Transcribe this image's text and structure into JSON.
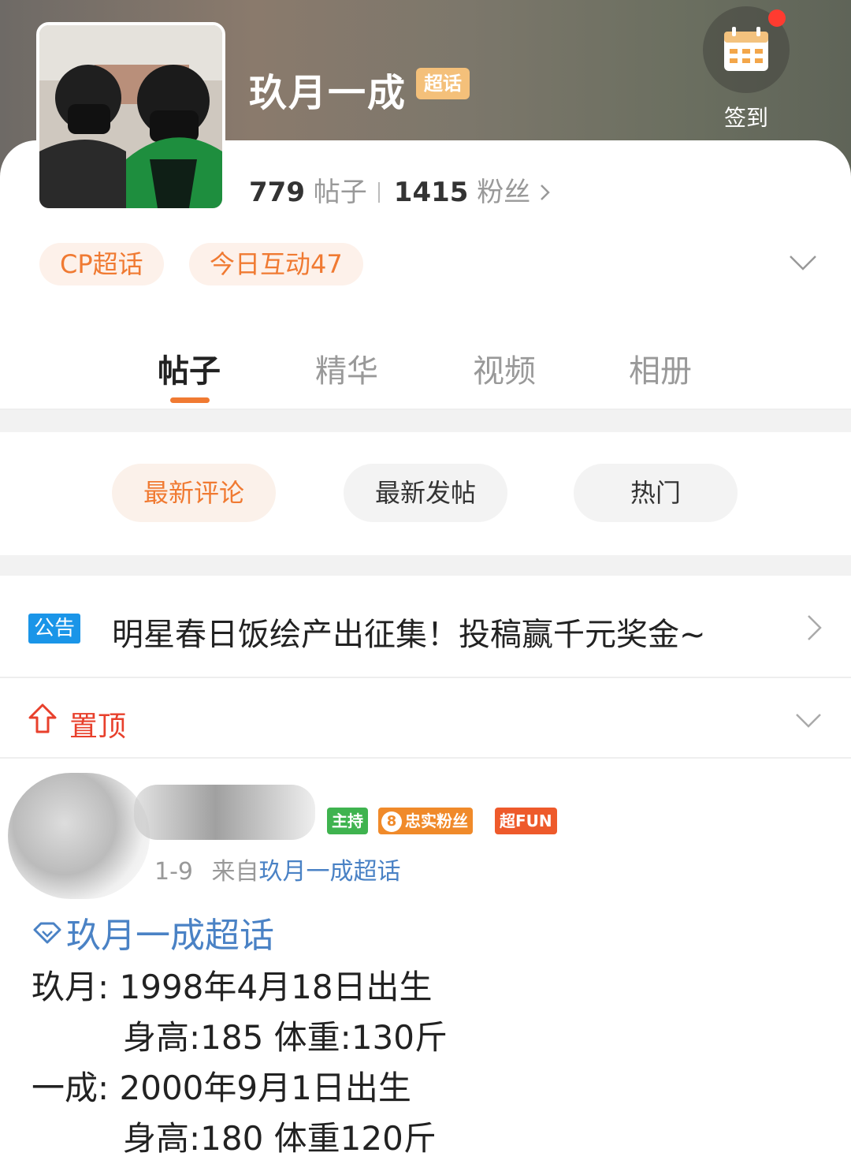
{
  "header": {
    "title": "玖月一成",
    "title_badge": "超话",
    "signin_label": "签到",
    "stats": {
      "posts_count": "779",
      "posts_label": "帖子",
      "fans_count": "1415",
      "fans_label": "粉丝"
    }
  },
  "pills": [
    "CP超话",
    "今日互动47"
  ],
  "tabs": [
    {
      "label": "帖子",
      "active": true
    },
    {
      "label": "精华",
      "active": false
    },
    {
      "label": "视频",
      "active": false
    },
    {
      "label": "相册",
      "active": false
    }
  ],
  "sort_buttons": [
    {
      "label": "最新评论",
      "active": true
    },
    {
      "label": "最新发帖",
      "active": false
    },
    {
      "label": "热门",
      "active": false
    }
  ],
  "notice": {
    "tag": "公告",
    "text": "明星春日饭绘产出征集！投稿赢千元奖金~"
  },
  "pinned": {
    "label": "置顶"
  },
  "post": {
    "badges": [
      "主持",
      "8",
      "忠实粉丝",
      "超FUN"
    ],
    "date": "1-9",
    "from_prefix": "来自",
    "from_link": "玖月一成超话",
    "topic": "玖月一成超话",
    "lines": [
      "玖月: 1998年4月18日出生",
      "身高:185 体重:130斤",
      "一成: 2000年9月1日出生",
      "身高:180 体重120斤"
    ]
  },
  "colors": {
    "accent": "#f07a32",
    "link": "#4a82c5",
    "notice_tag": "#1a95e8",
    "pinned": "#e8402c",
    "badge_host": "#3fb34f",
    "badge_fan": "#f08a2a",
    "badge_fun": "#ee5a2b"
  }
}
